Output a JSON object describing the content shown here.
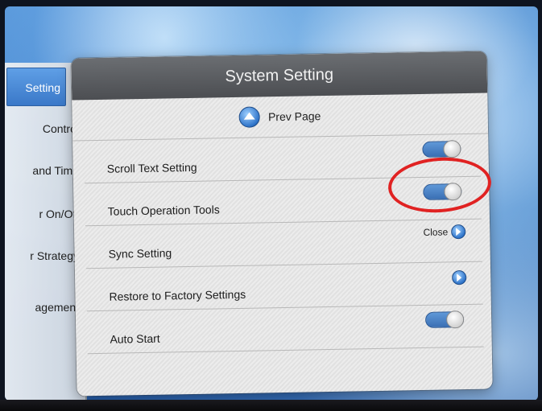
{
  "dialog": {
    "title": "System Setting",
    "prev_page": "Prev Page",
    "rows": [
      {
        "label": "Scroll Text Setting",
        "control": "toggle",
        "on": true
      },
      {
        "label": "Touch Operation Tools",
        "control": "toggle",
        "on": true
      },
      {
        "label": "Sync Setting",
        "control": "arrow",
        "value": "Close"
      },
      {
        "label": "Restore to Factory Settings",
        "control": "arrow"
      },
      {
        "label": "Auto Start",
        "control": "toggle",
        "on": true
      }
    ]
  },
  "side_menu": {
    "items": [
      {
        "label": "Setting",
        "active": true
      },
      {
        "label": "Control"
      },
      {
        "label": "and Time"
      },
      {
        "label": "r On/Off"
      },
      {
        "label": "r Strategy"
      },
      {
        "label": "agement"
      }
    ]
  },
  "colors": {
    "accent_blue": "#3a78c8",
    "highlight_red": "#e02222",
    "header_gray": "#4c4e52"
  }
}
